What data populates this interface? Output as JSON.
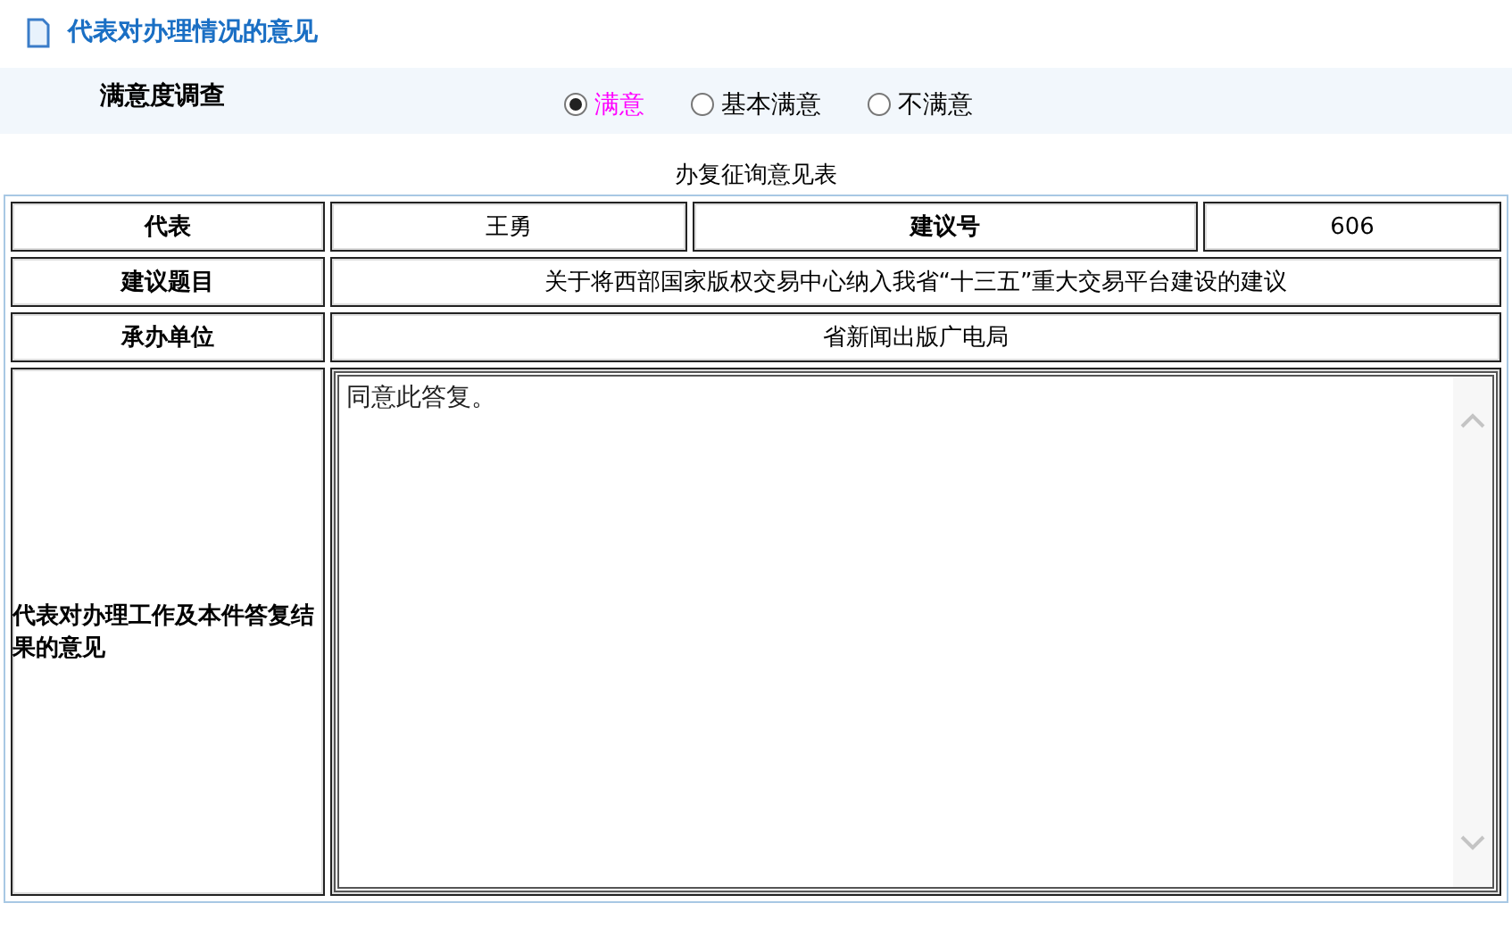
{
  "header": {
    "title": "代表对办理情况的意见"
  },
  "survey": {
    "label": "满意度调查",
    "options": [
      {
        "label": "满意",
        "selected": true
      },
      {
        "label": "基本满意",
        "selected": false
      },
      {
        "label": "不满意",
        "selected": false
      }
    ]
  },
  "form": {
    "caption": "办复征询意见表",
    "representative": {
      "label": "代表",
      "value": "王勇"
    },
    "proposal_number": {
      "label": "建议号",
      "value": "606"
    },
    "proposal_title": {
      "label": "建议题目",
      "value": "关于将西部国家版权交易中心纳入我省“十三五”重大交易平台建设的建议"
    },
    "handling_unit": {
      "label": "承办单位",
      "value": "省新闻出版广电局"
    },
    "opinion": {
      "label": "代表对办理工作及本件答复结果的意见",
      "value": "同意此答复。"
    }
  }
}
